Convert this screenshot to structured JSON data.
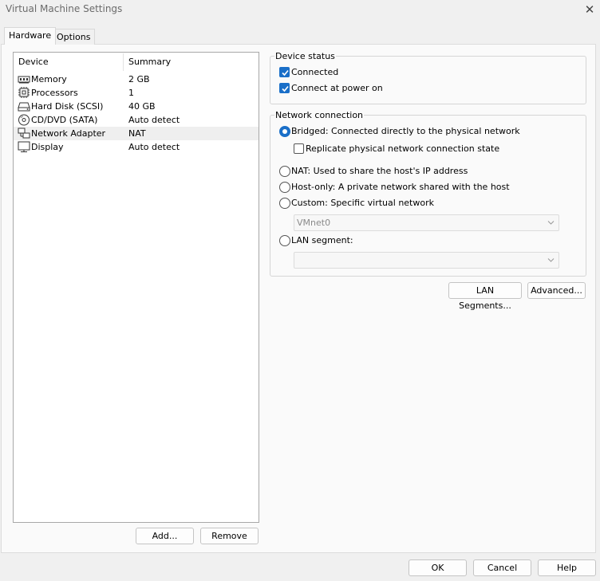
{
  "window": {
    "title": "Virtual Machine Settings",
    "close_glyph": "✕"
  },
  "tabs": [
    {
      "label": "Hardware",
      "active": true
    },
    {
      "label": "Options",
      "active": false
    }
  ],
  "device_list": {
    "columns": {
      "device": "Device",
      "summary": "Summary"
    },
    "rows": [
      {
        "name": "Memory",
        "summary": "2 GB",
        "icon": "memory-icon"
      },
      {
        "name": "Processors",
        "summary": "1",
        "icon": "processor-icon"
      },
      {
        "name": "Hard Disk (SCSI)",
        "summary": "40 GB",
        "icon": "hard-disk-icon"
      },
      {
        "name": "CD/DVD (SATA)",
        "summary": "Auto detect",
        "icon": "cd-dvd-icon"
      },
      {
        "name": "Network Adapter",
        "summary": "NAT",
        "icon": "network-adapter-icon",
        "selected": true
      },
      {
        "name": "Display",
        "summary": "Auto detect",
        "icon": "display-icon"
      }
    ],
    "add_label": "Add...",
    "remove_label": "Remove"
  },
  "device_status": {
    "legend": "Device status",
    "connected": {
      "label": "Connected",
      "checked": true
    },
    "connect_at_power_on": {
      "label": "Connect at power on",
      "checked": true
    }
  },
  "network_connection": {
    "legend": "Network connection",
    "bridged": {
      "label": "Bridged: Connected directly to the physical network",
      "checked": true
    },
    "replicate": {
      "label": "Replicate physical network connection state",
      "checked": false
    },
    "nat": {
      "label": "NAT: Used to share the host's IP address",
      "checked": false
    },
    "host_only": {
      "label": "Host-only: A private network shared with the host",
      "checked": false
    },
    "custom": {
      "label": "Custom: Specific virtual network",
      "checked": false
    },
    "vmnet_value": "VMnet0",
    "lan_segment": {
      "label": "LAN segment:",
      "checked": false
    },
    "lan_segment_value": ""
  },
  "side_buttons": {
    "lan_segments": "LAN Segments...",
    "advanced": "Advanced..."
  },
  "footer": {
    "ok": "OK",
    "cancel": "Cancel",
    "help": "Help"
  },
  "colors": {
    "accent": "#1a6fc8",
    "selection": "#efefef",
    "background": "#f0f0f0"
  }
}
